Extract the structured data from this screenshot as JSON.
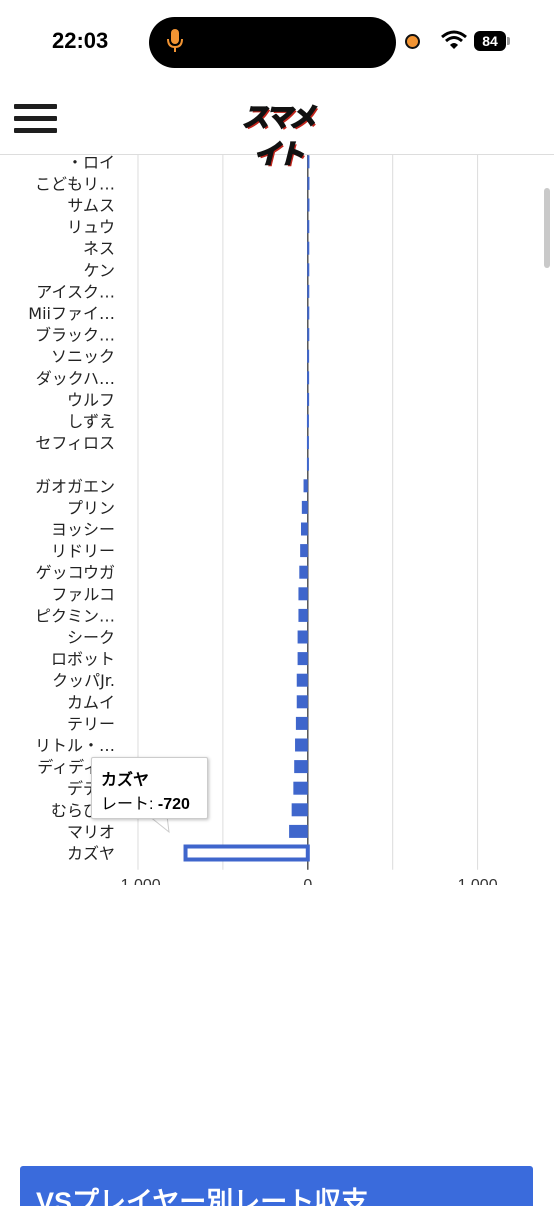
{
  "status_bar": {
    "time": "22:03",
    "battery": "84"
  },
  "header": {
    "logo_text": "スマメイト"
  },
  "chart_data": {
    "type": "bar",
    "orientation": "horizontal",
    "categories": [
      "・ロイ",
      "こどもリ…",
      "サムス",
      "リュウ",
      "ネス",
      "ケン",
      "アイスク…",
      "Miiファイ…",
      "ブラック…",
      "ソニック",
      "ダックハ…",
      "ウルフ",
      "しずえ",
      "セフィロス",
      "",
      "ガオガエン",
      "プリン",
      "ヨッシー",
      "リドリー",
      "ゲッコウガ",
      "ファルコ",
      "ピクミン…",
      "シーク",
      "ロボット",
      "クッパJr.",
      "カムイ",
      "テリー",
      "リトル・…",
      "ディディ…",
      "デデデ",
      "むらびと",
      "マリオ",
      "カズヤ"
    ],
    "values": [
      -2,
      -2,
      -2,
      -3,
      -3,
      -3,
      -3,
      -3,
      -3,
      -4,
      -4,
      -4,
      -5,
      -5,
      -5,
      -25,
      -35,
      -40,
      -45,
      -50,
      -55,
      -55,
      -60,
      -60,
      -65,
      -65,
      -70,
      -75,
      -80,
      -85,
      -95,
      -110,
      -720
    ],
    "xlim": [
      -1100,
      1450
    ],
    "xticks": [
      -1000,
      0,
      1000
    ],
    "xtick_labels": [
      "-1,000",
      "0",
      "1,000"
    ],
    "grid": true,
    "bar_color": "#3f66cc",
    "selected_index": 32
  },
  "tooltip": {
    "name": "カズヤ",
    "label": "レート: ",
    "value": "-720"
  },
  "section": {
    "title": "VSプレイヤー別レート収支"
  }
}
